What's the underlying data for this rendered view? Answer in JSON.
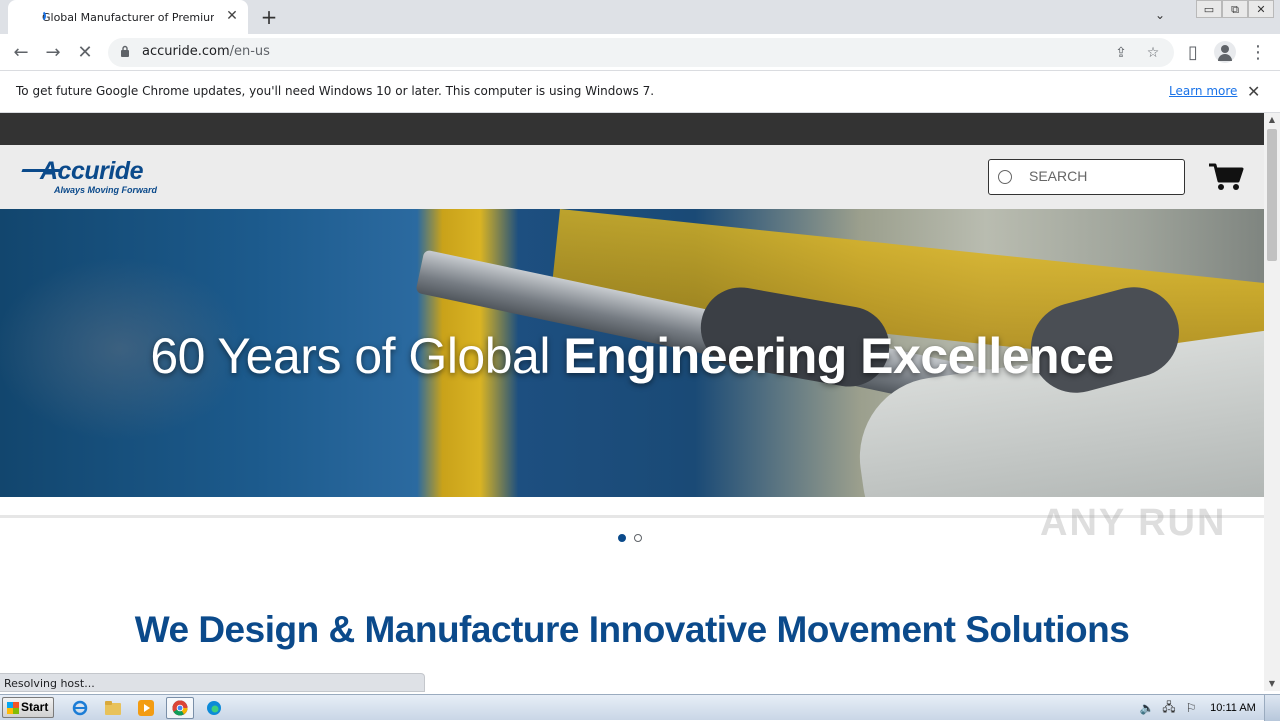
{
  "browser": {
    "tab_title": "Global Manufacturer of Premium Ball",
    "tab_close": "✕",
    "new_tab": "+",
    "tab_list": "⌄",
    "window_buttons": [
      "▭",
      "⧉",
      "✕"
    ],
    "back": "←",
    "forward": "→",
    "reload": "✕",
    "url_host": "accuride.com",
    "url_path": "/en-us",
    "share": "⇪",
    "star": "☆",
    "sidepanel": "▯",
    "menu": "⋮"
  },
  "infobar": {
    "message": "To get future Google Chrome updates, you'll need Windows 10 or later. This computer is using Windows 7.",
    "learn_more": "Learn more",
    "close": "✕"
  },
  "site": {
    "brand": "Accuride",
    "tagline": "Always Moving Forward",
    "search_placeholder": "SEARCH",
    "hero_light": "60 Years of Global ",
    "hero_bold": "Engineering Excellence",
    "section_title": "We Design & Manufacture Innovative Movement Solutions"
  },
  "status": {
    "text": "Resolving host..."
  },
  "watermark": "ANY RUN",
  "taskbar": {
    "start": "Start",
    "clock": "10:11 AM",
    "apps": [
      "ie-icon",
      "explorer-icon",
      "media-player-icon",
      "chrome-icon",
      "edge-icon"
    ]
  },
  "colors": {
    "brand_blue": "#0b4a8b",
    "topbar": "#333333",
    "link": "#1a73e8"
  },
  "carousel": {
    "slides": 2,
    "active": 1
  }
}
